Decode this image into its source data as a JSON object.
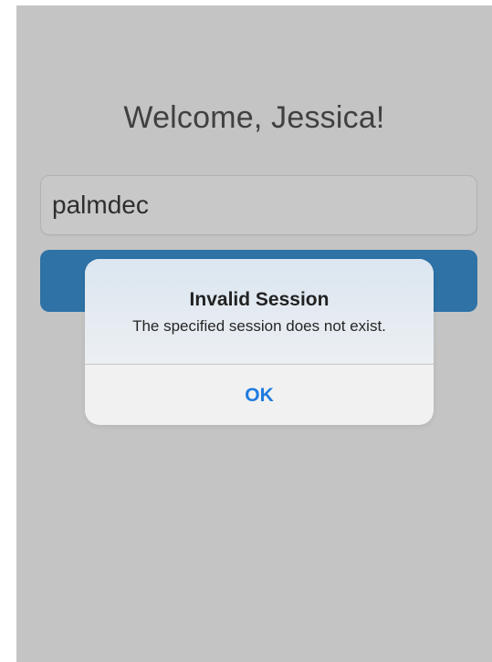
{
  "screen": {
    "welcome_text": "Welcome, Jessica!"
  },
  "session_field": {
    "value": "palmdec"
  },
  "primary_button": {
    "label": ""
  },
  "alert": {
    "title": "Invalid Session",
    "message": "The specified session does not exist.",
    "ok_label": "OK"
  },
  "colors": {
    "background": "#c4c4c4",
    "primary_button": "#2e72a6",
    "alert_action": "#1f7be0"
  }
}
